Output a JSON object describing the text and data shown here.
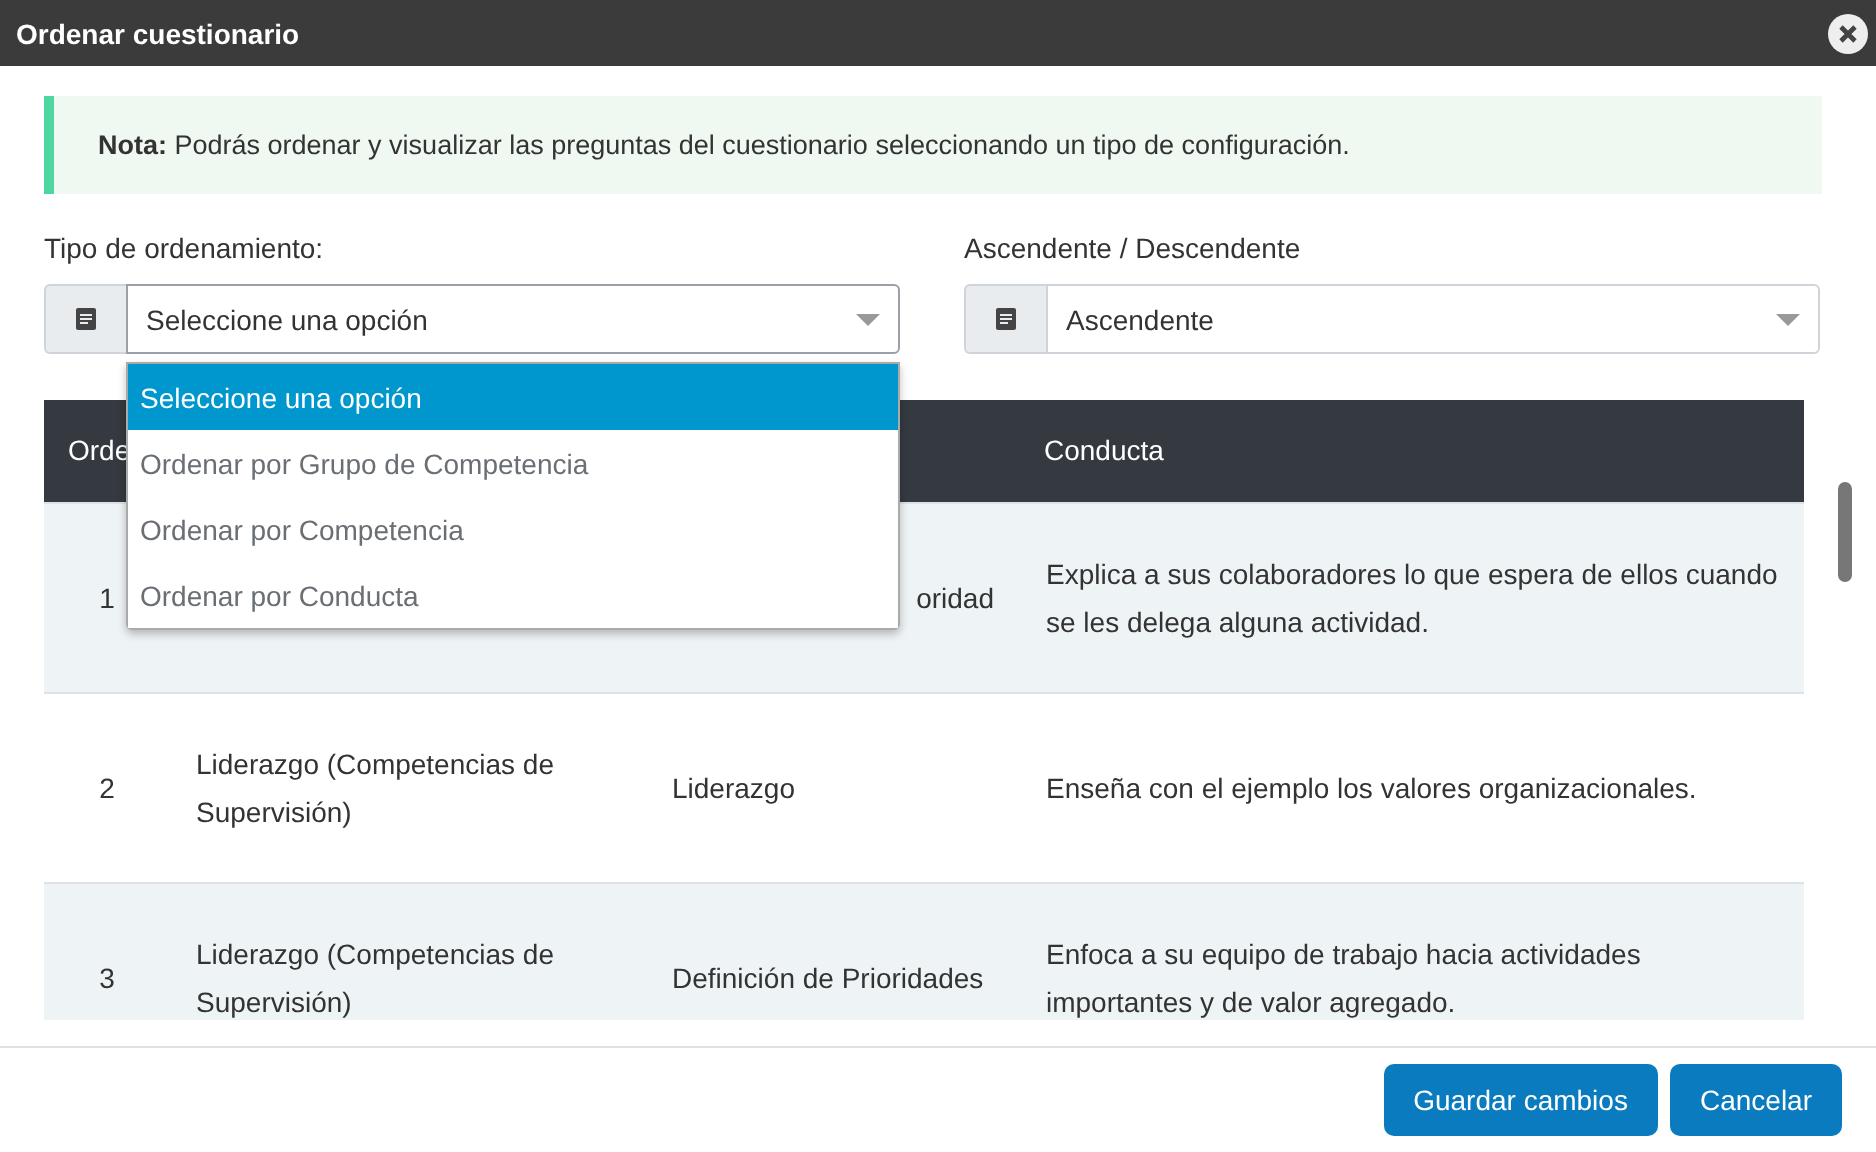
{
  "window": {
    "title": "Ordenar cuestionario"
  },
  "note": {
    "text": "**Nota:** Podrás ordenar y visualizar las preguntas del cuestionario seleccionando un tipo de configuración."
  },
  "sort_type": {
    "label": "Tipo de ordenamiento:",
    "value": "Seleccione una opción",
    "expanded": true,
    "options": [
      {
        "label": "Seleccione una opción",
        "selected": true
      },
      {
        "label": "Ordenar por Grupo de Competencia",
        "selected": false
      },
      {
        "label": "Ordenar por Competencia",
        "selected": false
      },
      {
        "label": "Ordenar por Conducta",
        "selected": false
      }
    ]
  },
  "direction": {
    "label": "Ascendente / Descendente",
    "value": "Ascendente",
    "expanded": false
  },
  "table": {
    "columns": [
      {
        "label": "Orde"
      },
      {},
      {},
      {
        "label": "Conducta"
      }
    ],
    "rows": [
      {
        "order": "1",
        "competency": "oridad",
        "competency_partial": true,
        "conduct": "Explica a sus colaboradores lo que espera de ellos cuando se les delega alguna actividad."
      },
      {
        "order": "2",
        "group": "Liderazgo (Competencias de Supervisión)",
        "competency": "Liderazgo",
        "competency_partial": false,
        "conduct": "Enseña con el ejemplo los valores organizacionales."
      },
      {
        "order": "3",
        "group": "Liderazgo (Competencias de Supervisión)",
        "competency": "Definición de Prioridades",
        "competency_partial": false,
        "conduct": "Enfoca a su equipo de trabajo hacia actividades importantes y de valor agregado."
      }
    ]
  },
  "buttons": [
    {
      "label": "Guardar cambios"
    },
    {
      "label": "Cancelar"
    }
  ]
}
